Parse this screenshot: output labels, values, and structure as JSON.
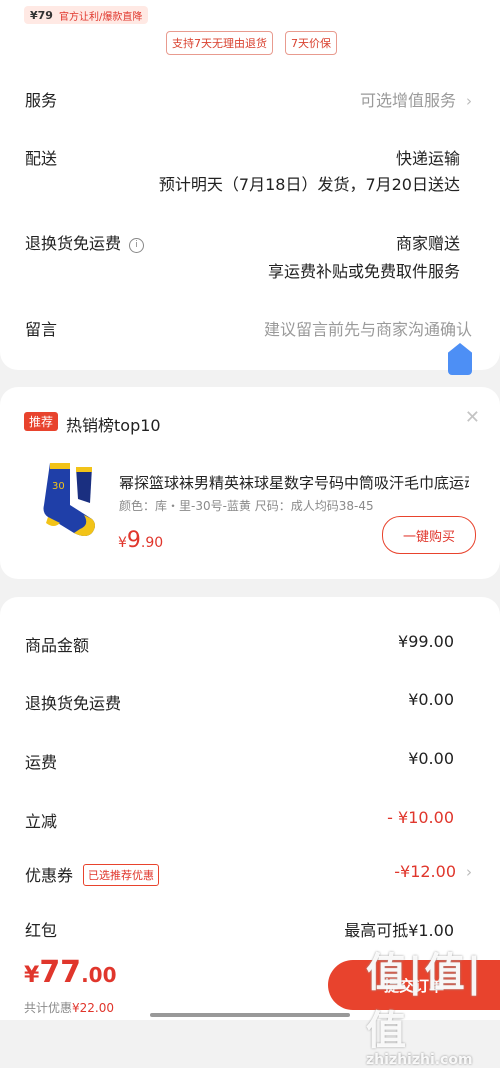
{
  "top_strip": {
    "price": "¥79",
    "text": "官方让利/爆款直降"
  },
  "service_tags": [
    "支持7天无理由退货",
    "7天价保"
  ],
  "rows": {
    "service": {
      "label": "服务",
      "value": "可选增值服务"
    },
    "delivery": {
      "label": "配送",
      "value": "快递运输",
      "sub": "预计明天（7月18日）发货，7月20日送达"
    },
    "return_free": {
      "label": "退换货免运费",
      "value": "商家赠送",
      "sub": "享运费补贴或免费取件服务"
    },
    "message": {
      "label": "留言",
      "placeholder": "建议留言前先与商家沟通确认"
    }
  },
  "recommend": {
    "badge": "推荐",
    "title": "热销榜top10",
    "product_title": "幂探篮球袜男精英袜球星数字号码中筒吸汗毛巾底运动袜",
    "spec": "颜色：库・里-30号-蓝黄   尺码：成人均码38-45",
    "price_currency": "¥",
    "price_int": "9",
    "price_dec": ".90",
    "buy_label": "一键购买"
  },
  "summary": {
    "items": [
      {
        "label": "商品金额",
        "value": "¥99.00"
      },
      {
        "label": "退换货免运费",
        "value": "¥0.00"
      },
      {
        "label": "运费",
        "value": "¥0.00"
      },
      {
        "label": "立减",
        "value": "- ¥10.00"
      },
      {
        "label": "优惠券",
        "tag": "已选推荐优惠",
        "value": "-¥12.00"
      },
      {
        "label": "红包",
        "value": "最高可抵¥1.00"
      }
    ]
  },
  "bottom": {
    "total_currency": "¥",
    "total_int": "77",
    "total_dec": ".00",
    "saved_label": "共计优惠",
    "saved_value": "¥22.00",
    "submit_label": "提交订单"
  },
  "watermark": {
    "zh": "值|值|值",
    "en": "zhizhizhi.com"
  },
  "colors": {
    "accent": "#e8432d",
    "price_red": "#e0362c",
    "background": "#f2f2f2"
  },
  "icons": [
    "info-icon",
    "chevron-right-icon",
    "close-icon",
    "float-button-icon"
  ]
}
